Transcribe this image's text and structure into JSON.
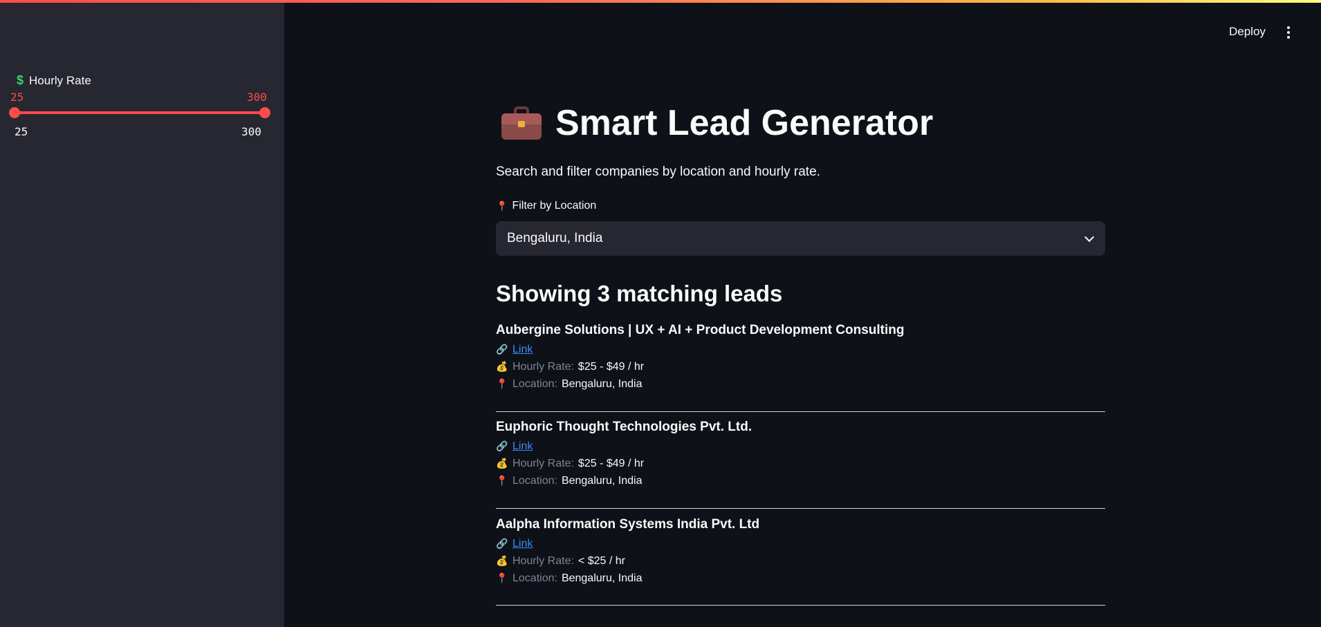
{
  "sidebar": {
    "slider": {
      "label": "Hourly Rate",
      "icon": "dollar-icon",
      "value_low": "25",
      "value_high": "300",
      "min_label": "25",
      "max_label": "300",
      "low_fraction": 0.0,
      "high_fraction": 1.0
    }
  },
  "header": {
    "deploy_label": "Deploy",
    "menu_icon": "vertical-dots-icon"
  },
  "main": {
    "title": "Smart Lead Generator",
    "title_icon": "briefcase-icon",
    "subtitle": "Search and filter companies by location and hourly rate.",
    "location_filter": {
      "label": "Filter by Location",
      "icon": "pin-icon",
      "selected": "Bengaluru, India"
    },
    "results_heading": "Showing 3 matching leads",
    "link_icon_glyph": "🔗",
    "bag_icon_glyph": "💰",
    "pin_icon_glyph": "📍",
    "leads": [
      {
        "name": "Aubergine Solutions | UX + AI + Product Development Consulting",
        "link_label": "Link",
        "rate_label": "Hourly Rate:",
        "rate_value": "$25 - $49 / hr",
        "location_label": "Location:",
        "location_value": "Bengaluru, India"
      },
      {
        "name": "Euphoric Thought Technologies Pvt. Ltd.",
        "link_label": "Link",
        "rate_label": "Hourly Rate:",
        "rate_value": "$25 - $49 / hr",
        "location_label": "Location:",
        "location_value": "Bengaluru, India"
      },
      {
        "name": "Aalpha Information Systems India Pvt. Ltd",
        "link_label": "Link",
        "rate_label": "Hourly Rate:",
        "rate_value": "< $25 / hr",
        "location_label": "Location:",
        "location_value": "Bengaluru, India"
      }
    ]
  },
  "colors": {
    "accent": "#ff4b4b",
    "background": "#0e1117",
    "sidebar": "#262730",
    "link": "#3d8bfd"
  }
}
